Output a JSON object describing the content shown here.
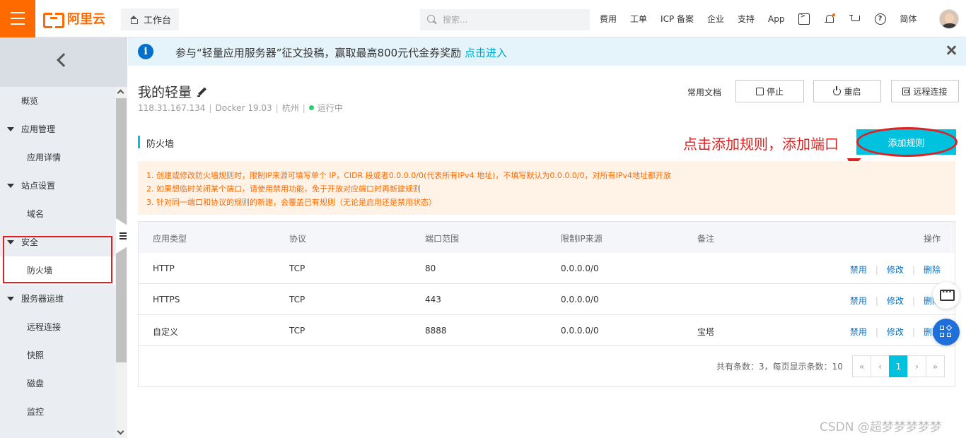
{
  "topbar": {
    "logo_text": "阿里云",
    "workbench": "工作台",
    "search_placeholder": "搜索...",
    "links": [
      "费用",
      "工单",
      "ICP 备案",
      "企业",
      "支持",
      "App"
    ],
    "lang": "简体",
    "accent": "#ff6a00"
  },
  "sidebar": {
    "items": [
      {
        "label": "概览"
      },
      {
        "label": "应用管理"
      },
      {
        "label": "应用详情"
      },
      {
        "label": "站点设置"
      },
      {
        "label": "域名"
      },
      {
        "label": "安全"
      },
      {
        "label": "防火墙"
      },
      {
        "label": "服务器运维"
      },
      {
        "label": "远程连接"
      },
      {
        "label": "快照"
      },
      {
        "label": "磁盘"
      },
      {
        "label": "监控"
      }
    ]
  },
  "notice": {
    "text": "参与“轻量应用服务器”征文投稿，赢取最高800元代金券奖励 ",
    "link": "点击进入"
  },
  "instance": {
    "title": "我的轻量",
    "ip": "118.31.167.134",
    "image": "Docker 19.03",
    "region": "杭州",
    "status": "运行中",
    "docs": "常用文档",
    "stop": "停止",
    "restart": "重启",
    "remote": "远程连接"
  },
  "firewall": {
    "title": "防火墙",
    "annotation": "点击添加规则，添加端口",
    "add_button": "添加规则",
    "tips": [
      "1. 创建或修改防火墙规则时，限制IP来源可填写单个 IP，CIDR 段或者0.0.0.0/0(代表所有IPv4 地址)，不填写默认为0.0.0.0/0，对所有IPv4地址都开放",
      "2. 如果想临时关闭某个端口，请使用禁用功能，免于开放对应端口时再新建规则",
      "3. 针对同一端口和协议的规则的新建，会覆盖已有规则（无论是启用还是禁用状态）"
    ],
    "columns": [
      "应用类型",
      "协议",
      "端口范围",
      "限制IP来源",
      "备注",
      "操作"
    ],
    "rows": [
      [
        "HTTP",
        "TCP",
        "80",
        "0.0.0.0/0",
        ""
      ],
      [
        "HTTPS",
        "TCP",
        "443",
        "0.0.0.0/0",
        ""
      ],
      [
        "自定义",
        "TCP",
        "8888",
        "0.0.0.0/0",
        "宝塔"
      ]
    ],
    "ops": [
      "禁用",
      "修改",
      "删除"
    ],
    "pager_info": "共有条数：3，每页显示条数：10",
    "pager": [
      "«",
      "‹",
      "1",
      "›",
      "»"
    ]
  },
  "watermark": "CSDN @超梦梦梦梦梦"
}
